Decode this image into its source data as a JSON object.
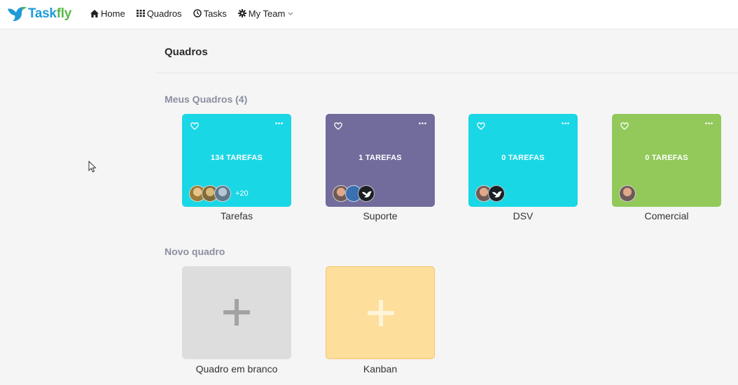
{
  "app": {
    "logo_task": "Task",
    "logo_fly": "fly",
    "colors": {
      "brand_blue": "#1f9bd7",
      "brand_green": "#59b84a"
    }
  },
  "nav": {
    "items": [
      {
        "label": "Home",
        "icon": "home-icon"
      },
      {
        "label": "Quadros",
        "icon": "grid-icon"
      },
      {
        "label": "Tasks",
        "icon": "clock-icon"
      },
      {
        "label": "My Team",
        "icon": "gear-icon",
        "has_dropdown": true
      }
    ]
  },
  "page": {
    "title": "Quadros",
    "my_boards_heading": "Meus Quadros (4)",
    "new_board_heading": "Novo quadro"
  },
  "boards": [
    {
      "name": "Tarefas",
      "count_label": "134 TAREFAS",
      "color": "#1ad7e5",
      "extra_members": "+20",
      "members": 3
    },
    {
      "name": "Suporte",
      "count_label": "1 TAREFAS",
      "color": "#726c9c",
      "extra_members": "",
      "members": 3
    },
    {
      "name": "DSV",
      "count_label": "0 TAREFAS",
      "color": "#1ad7e5",
      "extra_members": "",
      "members": 2
    },
    {
      "name": "Comercial",
      "count_label": "0 TAREFAS",
      "color": "#92c95a",
      "extra_members": "",
      "members": 1
    }
  ],
  "templates": [
    {
      "name": "Quadro em branco",
      "color": "#dddddd",
      "plus_color": "#a3a3a3"
    },
    {
      "name": "Kanban",
      "color": "#fdde9b",
      "plus_color": "#fff3d8"
    }
  ]
}
